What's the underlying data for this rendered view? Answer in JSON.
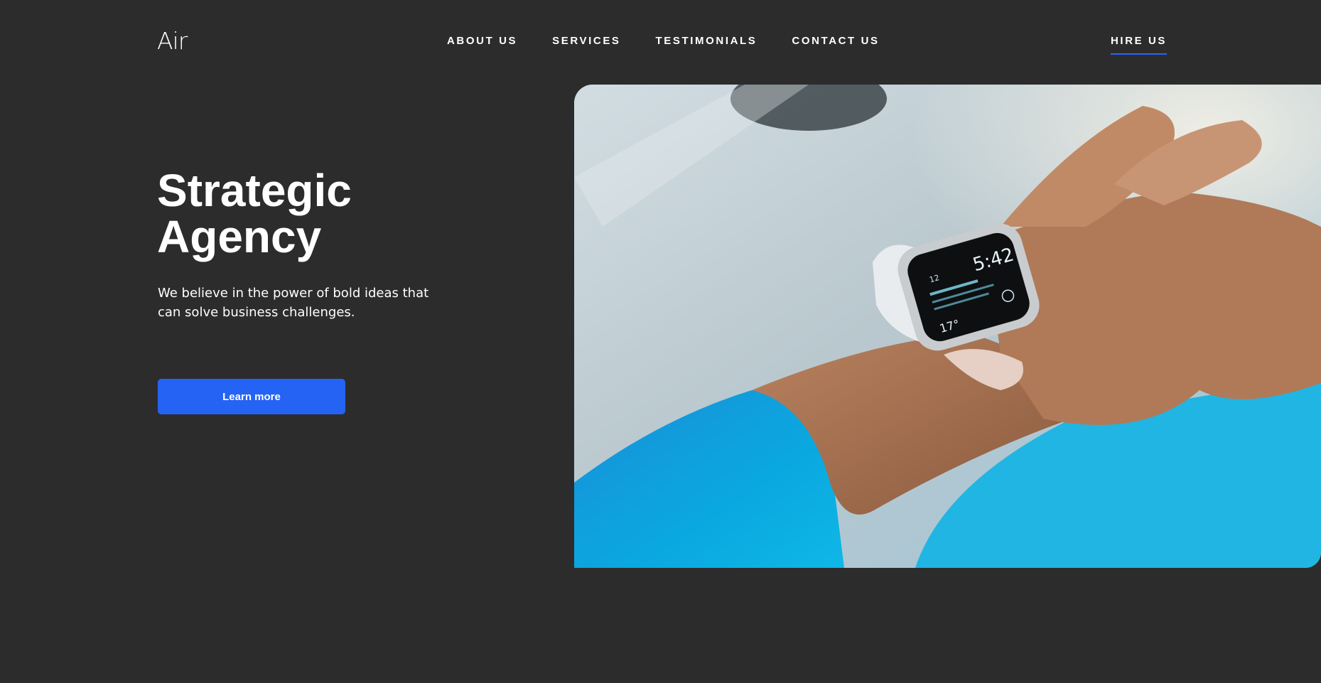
{
  "header": {
    "logo": "Air",
    "nav": [
      {
        "label": "ABOUT US"
      },
      {
        "label": "SERVICES"
      },
      {
        "label": "TESTIMONIALS"
      },
      {
        "label": "CONTACT US"
      }
    ],
    "hire_label": "HIRE US"
  },
  "hero": {
    "title": "Strategic\nAgency",
    "subtitle": "We believe in the power of bold ideas that can solve business challenges.",
    "cta_label": "Learn more",
    "image_alt": "Person checking smartwatch",
    "watch": {
      "time": "5:42",
      "date_num": "12",
      "temp": "17°"
    }
  },
  "colors": {
    "background": "#2c2c2c",
    "accent": "#2563f4",
    "text": "#ffffff"
  }
}
